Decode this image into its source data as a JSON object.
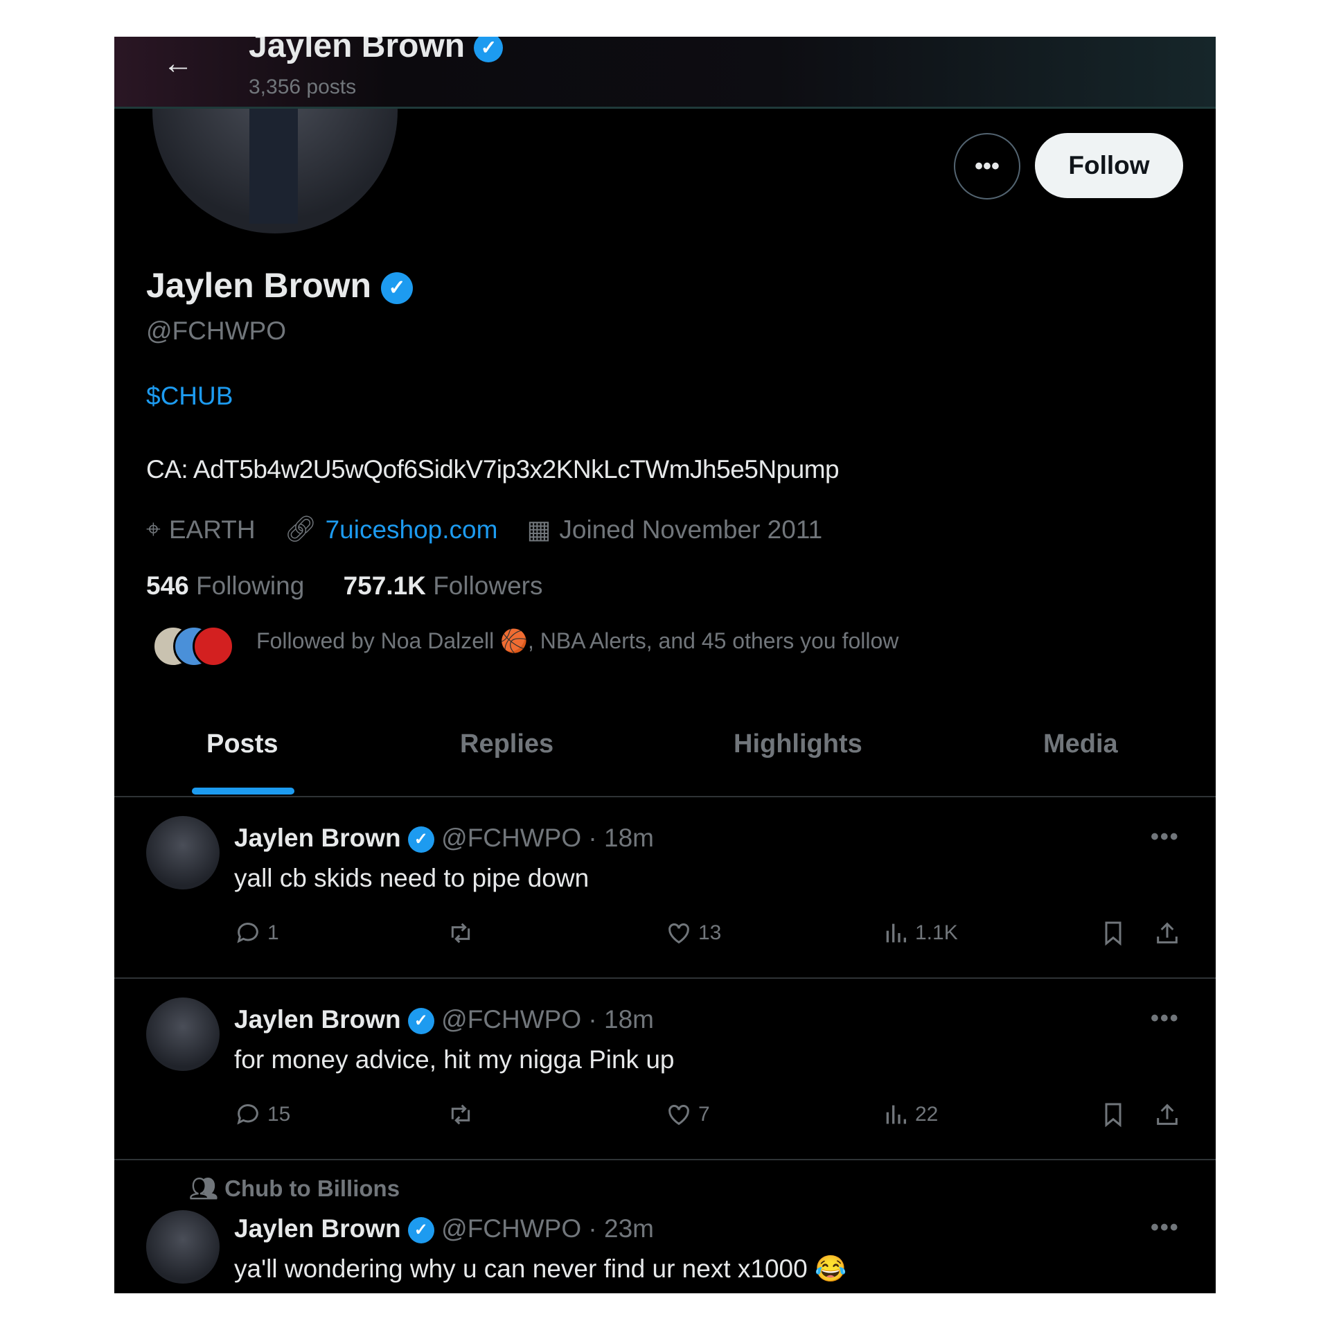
{
  "header": {
    "name": "Jaylen Brown",
    "posts": "3,356 posts"
  },
  "profile": {
    "name": "Jaylen Brown",
    "handle": "@FCHWPO",
    "bio_link": "$CHUB",
    "bio": "CA: AdT5b4w2U5wQof6SidkV7ip3x2KNkLcTWmJh5e5Npump",
    "location": "EARTH",
    "website": "7uiceshop.com",
    "joined": "Joined November 2011",
    "following_count": "546",
    "following_label": "Following",
    "followers_count": "757.1K",
    "followers_label": "Followers",
    "followed_by": "Followed by Noa Dalzell 🏀, NBA Alerts, and 45 others you follow",
    "follow_label": "Follow"
  },
  "tabs": [
    "Posts",
    "Replies",
    "Highlights",
    "Media"
  ],
  "posts": [
    {
      "name": "Jaylen Brown",
      "handle": "@FCHWPO",
      "time": "· 18m",
      "text": "yall cb skids need to pipe down",
      "replies": "1",
      "reposts": "",
      "likes": "13",
      "views": "1.1K"
    },
    {
      "name": "Jaylen Brown",
      "handle": "@FCHWPO",
      "time": "· 18m",
      "text": "for money advice, hit my nigga Pink up",
      "replies": "15",
      "reposts": "",
      "likes": "7",
      "views": "22"
    },
    {
      "community": "Chub to Billions",
      "name": "Jaylen Brown",
      "handle": "@FCHWPO",
      "time": "· 23m",
      "text": "ya'll wondering why u can never find ur next x1000 😂"
    }
  ],
  "colors": {
    "accent": "#1d9bf0",
    "background": "#000000",
    "muted": "#71767b"
  }
}
